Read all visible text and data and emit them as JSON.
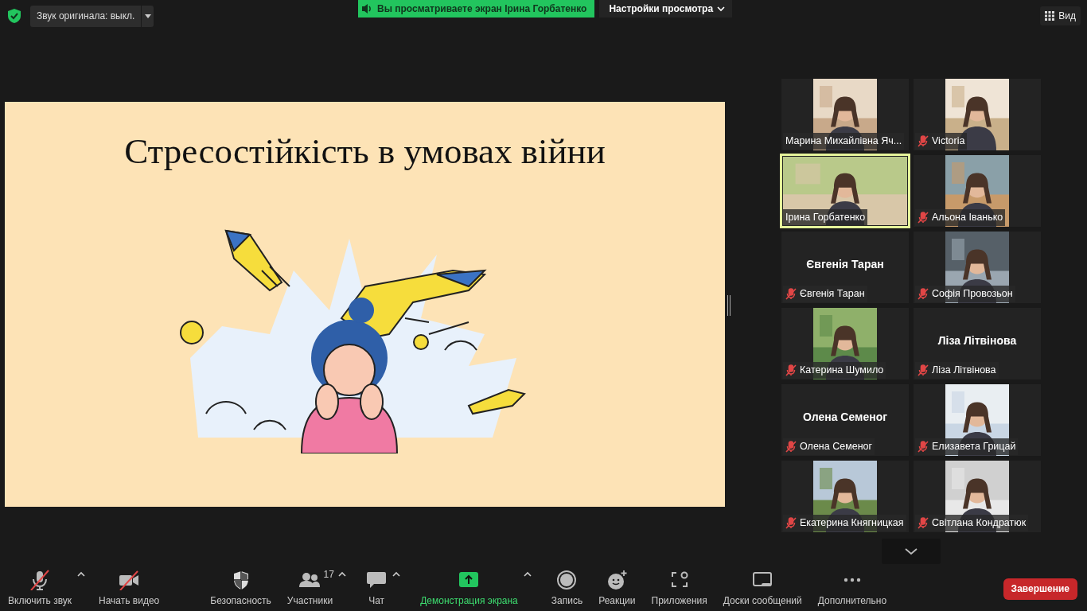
{
  "top_bar": {
    "audio_button": "Звук оригинала: выкл.",
    "banner": "Вы просматриваете экран Ірина Горбатенко",
    "view_settings": "Настройки просмотра",
    "view_button": "Вид"
  },
  "slide": {
    "title": "Стресостійкість в умовах війни"
  },
  "tiles": [
    {
      "name": "Марина Михайлівна Яч...",
      "muted": false,
      "speaking": false,
      "kind": "video"
    },
    {
      "name": "Victoria",
      "muted": true,
      "speaking": false,
      "kind": "video"
    },
    {
      "name": "Ірина Горбатенко",
      "muted": false,
      "speaking": true,
      "kind": "video_wide"
    },
    {
      "name": "Альона Іванько",
      "muted": true,
      "speaking": false,
      "kind": "video"
    },
    {
      "name": "Євгенія Таран",
      "muted": true,
      "speaking": false,
      "kind": "name",
      "display_name": "Євгенія Таран"
    },
    {
      "name": "Софія Провозьон",
      "muted": true,
      "speaking": false,
      "kind": "video"
    },
    {
      "name": "Катерина Шумило",
      "muted": true,
      "speaking": false,
      "kind": "video"
    },
    {
      "name": "Ліза Літвінова",
      "muted": true,
      "speaking": false,
      "kind": "name",
      "display_name": "Ліза Літвінова"
    },
    {
      "name": "Олена Семеног",
      "muted": true,
      "speaking": false,
      "kind": "name",
      "display_name": "Олена Семеног"
    },
    {
      "name": "Елизавета Грицай",
      "muted": true,
      "speaking": false,
      "kind": "video"
    },
    {
      "name": "Екатерина Княгницкая",
      "muted": true,
      "speaking": false,
      "kind": "video"
    },
    {
      "name": "Світлана Кондратюк",
      "muted": true,
      "speaking": false,
      "kind": "video"
    }
  ],
  "toolbar": [
    {
      "label": "Включить звук",
      "kind": "mic_off",
      "caret": true,
      "highlight": false
    },
    {
      "label": "Начать видео",
      "kind": "video_off",
      "caret": false,
      "highlight": false
    },
    {
      "label": "Безопасность",
      "kind": "shield",
      "caret": false,
      "highlight": false
    },
    {
      "label": "Участники",
      "kind": "people",
      "caret": true,
      "highlight": false,
      "badge": "17"
    },
    {
      "label": "Чат",
      "kind": "chat",
      "caret": true,
      "highlight": false
    },
    {
      "label": "Демонстрация экрана",
      "kind": "share",
      "caret": true,
      "highlight": true
    },
    {
      "label": "Запись",
      "kind": "record",
      "caret": false,
      "highlight": false
    },
    {
      "label": "Реакции",
      "kind": "reaction",
      "caret": false,
      "highlight": false
    },
    {
      "label": "Приложения",
      "kind": "apps",
      "caret": false,
      "highlight": false
    },
    {
      "label": "Доски сообщений",
      "kind": "whiteboard",
      "caret": false,
      "highlight": false
    },
    {
      "label": "Дополнительно",
      "kind": "more",
      "caret": false,
      "highlight": false
    }
  ],
  "end_button": "Завершение"
}
